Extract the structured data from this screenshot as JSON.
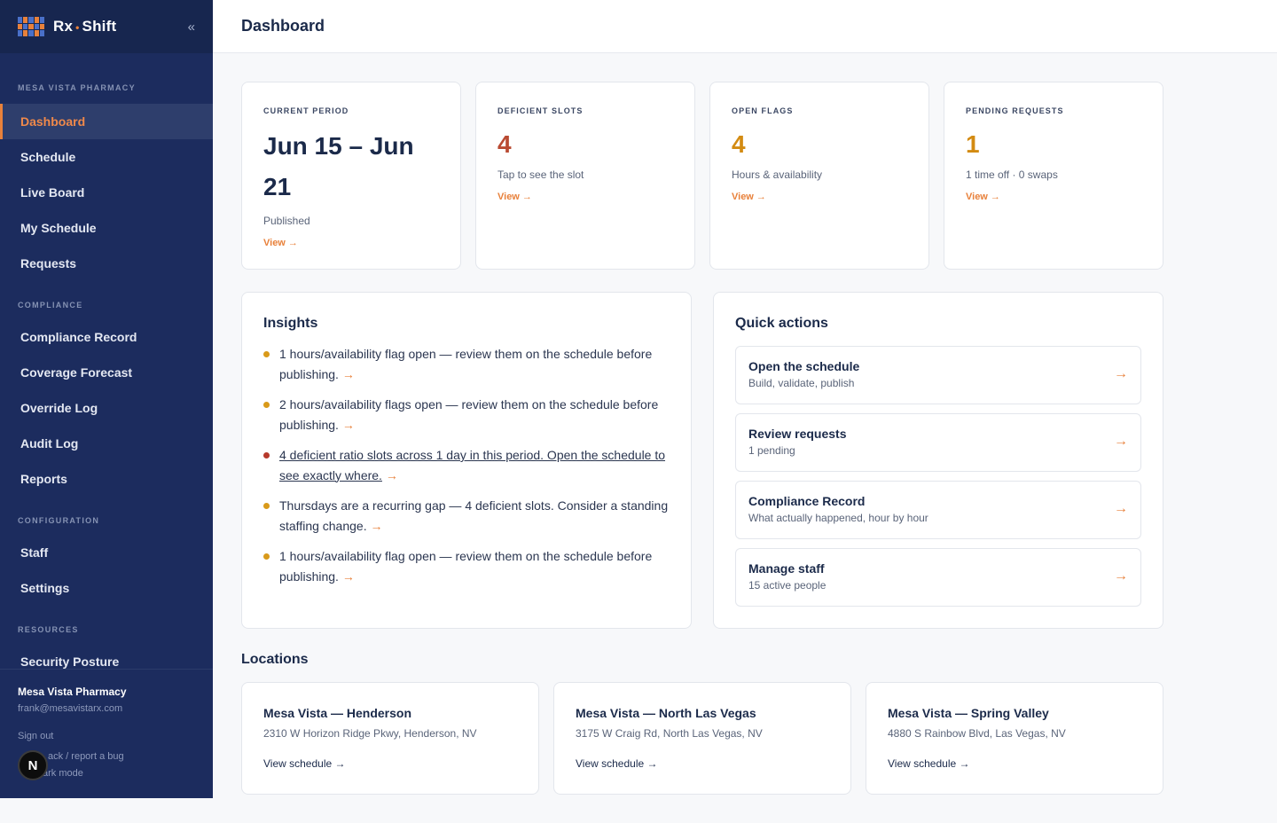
{
  "brand": {
    "name_left": "Rx",
    "separator": "•",
    "name_right": "Shift",
    "collapse_glyph": "«"
  },
  "sidebar": {
    "org_section": "MESA VISTA PHARMACY",
    "main_items": [
      {
        "label": "Dashboard",
        "active": true
      },
      {
        "label": "Schedule"
      },
      {
        "label": "Live Board"
      },
      {
        "label": "My Schedule"
      },
      {
        "label": "Requests"
      }
    ],
    "compliance_section": "COMPLIANCE",
    "compliance_items": [
      {
        "label": "Compliance Record"
      },
      {
        "label": "Coverage Forecast"
      },
      {
        "label": "Override Log"
      },
      {
        "label": "Audit Log"
      },
      {
        "label": "Reports"
      }
    ],
    "config_section": "CONFIGURATION",
    "config_items": [
      {
        "label": "Staff"
      },
      {
        "label": "Settings"
      }
    ],
    "resources_section": "RESOURCES",
    "resources_items": [
      {
        "label": "Security Posture"
      }
    ],
    "footer": {
      "org": "Mesa Vista Pharmacy",
      "email": "frank@mesavistarx.com",
      "sign_out": "Sign out",
      "feedback": "ack / report a bug",
      "dark_mode": "ark mode",
      "badge": "N"
    }
  },
  "header": {
    "title": "Dashboard"
  },
  "stats": [
    {
      "label": "CURRENT PERIOD",
      "value": "Jun 15 – Jun 21",
      "sub": "Published",
      "link": "View →"
    },
    {
      "label": "DEFICIENT SLOTS",
      "value": "4",
      "sub": "Tap to see the slot",
      "link": "View →"
    },
    {
      "label": "OPEN FLAGS",
      "value": "4",
      "sub": "Hours & availability",
      "link": "View →"
    },
    {
      "label": "PENDING REQUESTS",
      "value": "1",
      "sub": "1 time off · 0 swaps",
      "link": "View →"
    }
  ],
  "insights": {
    "title": "Insights",
    "items": [
      {
        "text": "1 hours/availability flag open — review them on the schedule before publishing.",
        "arrow": "→",
        "severity": "warning"
      },
      {
        "text": "2 hours/availability flags open — review them on the schedule before publishing.",
        "arrow": "→",
        "severity": "warning"
      },
      {
        "text": "4 deficient ratio slots across 1 day in this period. Open the schedule to see exactly where.",
        "arrow": "→",
        "severity": "critical"
      },
      {
        "text": "Thursdays are a recurring gap — 4 deficient slots. Consider a standing staffing change.",
        "arrow": "→",
        "severity": "warning"
      },
      {
        "text": "1 hours/availability flag open — review them on the schedule before publishing.",
        "arrow": "→",
        "severity": "warning"
      }
    ]
  },
  "quick_actions": {
    "title": "Quick actions",
    "items": [
      {
        "title": "Open the schedule",
        "sub": "Build, validate, publish",
        "arrow": "→"
      },
      {
        "title": "Review requests",
        "sub": "1 pending",
        "arrow": "→"
      },
      {
        "title": "Compliance Record",
        "sub": "What actually happened, hour by hour",
        "arrow": "→"
      },
      {
        "title": "Manage staff",
        "sub": "15 active people",
        "arrow": "→"
      }
    ]
  },
  "locations": {
    "title": "Locations",
    "items": [
      {
        "name": "Mesa Vista — Henderson",
        "address": "2310 W Horizon Ridge Pkwy, Henderson, NV",
        "link": "View schedule →"
      },
      {
        "name": "Mesa Vista — North Las Vegas",
        "address": "3175 W Craig Rd, North Las Vegas, NV",
        "link": "View schedule →"
      },
      {
        "name": "Mesa Vista — Spring Valley",
        "address": "4880 S Rainbow Blvd, Las Vegas, NV",
        "link": "View schedule →"
      }
    ]
  },
  "colors": {
    "sidebar_bg": "#1c2c5e",
    "accent": "#e8813b",
    "critical": "#b94a32",
    "warning": "#d38b12"
  }
}
